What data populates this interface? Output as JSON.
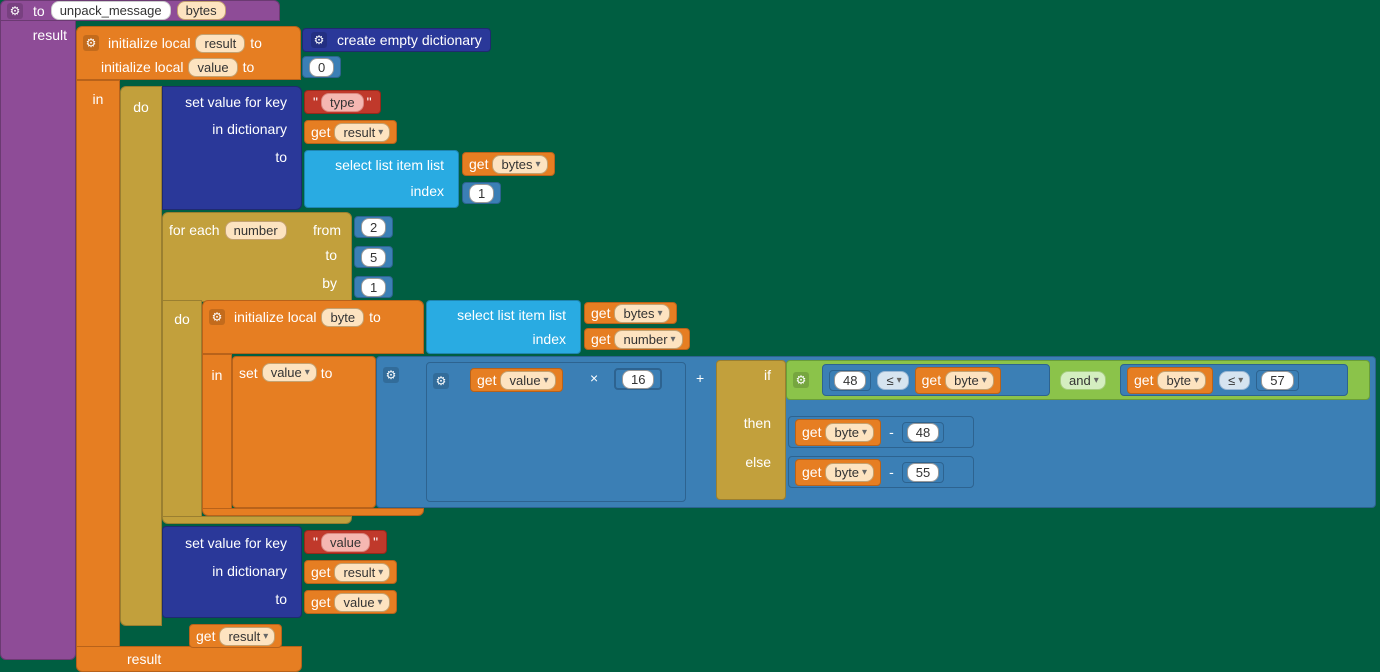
{
  "header": {
    "to": "to",
    "proc": "unpack_message",
    "arg": "bytes",
    "result": "result"
  },
  "init": {
    "initLocal": "initialize local",
    "result": "result",
    "value": "value",
    "to": "to",
    "createDict": "create empty dictionary",
    "zero": "0",
    "in": "in"
  },
  "do1": {
    "do": "do",
    "setKey": "set value for key",
    "inDict": "in dictionary",
    "to": "to",
    "typeStr": "type",
    "get": "get",
    "result": "result",
    "selectList": "select list item  list",
    "index": "index",
    "bytes": "bytes",
    "one": "1"
  },
  "foreach": {
    "forEach": "for each",
    "number": "number",
    "from": "from",
    "to": "to",
    "by": "by",
    "two": "2",
    "five": "5",
    "one": "1",
    "do": "do"
  },
  "inner": {
    "initLocal": "initialize local",
    "byte": "byte",
    "to": "to",
    "selectList": "select list item  list",
    "index": "index",
    "get": "get",
    "bytes": "bytes",
    "number": "number",
    "in": "in",
    "set": "set",
    "value": "value",
    "setTo": "to",
    "times": "×",
    "sixteen": "16",
    "plus": "+",
    "if": "if",
    "and": "and",
    "lte": "≤",
    "fortyeight": "48",
    "fiftyseven": "57",
    "then": "then",
    "else": "else",
    "minus": "-",
    "fiftyfive": "55"
  },
  "final": {
    "setKey": "set value for key",
    "valueStr": "value",
    "inDict": "in dictionary",
    "to": "to",
    "get": "get",
    "result": "result",
    "value": "value",
    "resultLbl": "result"
  }
}
